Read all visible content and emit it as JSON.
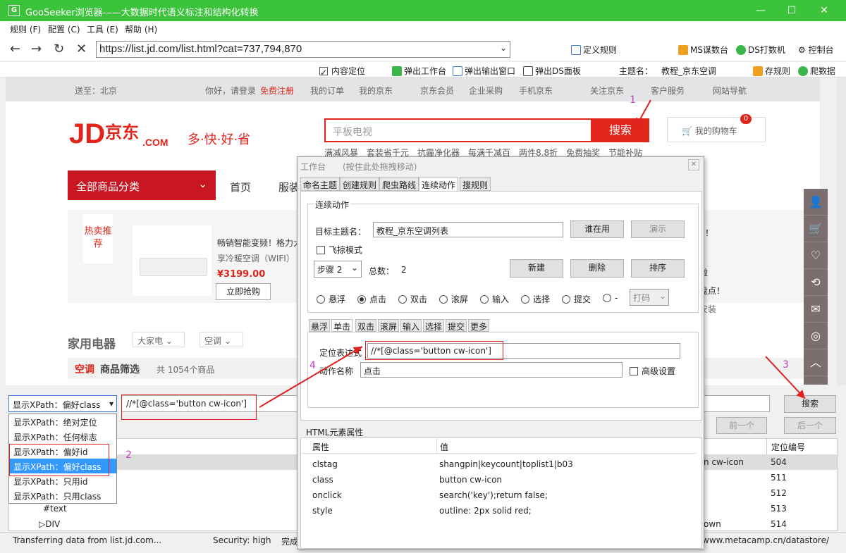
{
  "window": {
    "title": "GooSeeker浏览器——大数据时代语义标注和结构化转换",
    "logo": "G"
  },
  "menu": [
    "规则 (F)",
    "配置 (C)",
    "工具 (E)",
    "帮助 (H)"
  ],
  "nav": {
    "url": "https://list.jd.com/list.html?cat=737,794,870",
    "define_rule": "定义规则",
    "ms": "MS谋数台",
    "ds": "DS打数机",
    "console": "控制台"
  },
  "toolbar2": {
    "content_locate": "内容定位",
    "pop_workbench": "弹出工作台",
    "pop_output": "弹出输出窗口",
    "pop_ds": "弹出DS面板",
    "theme_label": "主题名：",
    "theme_value": "教程_京东空调",
    "save_rule": "存规则",
    "crawl": "爬数据"
  },
  "jd": {
    "top": {
      "ship_to": "送至：北京",
      "hello": "你好，请登录",
      "register": "免费注册",
      "orders": "我的订单",
      "myjd": "我的京东",
      "member": "京东会员",
      "enterprise": "企业采购",
      "mobile": "手机京东",
      "follow": "关注京东",
      "service": "客户服务",
      "sitenav": "网站导航"
    },
    "logo": "JD",
    "logo_cn": "京东",
    "logo_com": ".COM",
    "slogan": "多·快·好·省",
    "search_placeholder": "平板电视",
    "search_btn": "搜索",
    "cart": "我的购物车",
    "cart_count": "0",
    "hotwords": "满减风暴　套装省千元　抗霾净化器　每满千减百　两件8.8折　免费抽奖　节能补贴",
    "all_cat": "全部商品分类",
    "nav_home": "首页",
    "nav_clothes": "服装",
    "promo_tag": "热卖推荐",
    "promo_line1": "畅销智能变频！格力大",
    "promo_line2": "享冷暖空调（WIFI）",
    "price": "¥3199.00",
    "buy": "立即抢购",
    "right_text1": "到！",
    "right_text2": "啦",
    "right_text3": "盘点！",
    "right_text4": "安装",
    "cat_title": "家用电器",
    "crumb1": "大家电",
    "crumb2": "空调",
    "filter_red": "空调",
    "filter_title": "商品筛选",
    "filter_count": "共 1054个商品"
  },
  "bottom": {
    "select_value": "显示XPath：偏好class",
    "options": [
      "显示XPath：绝对定位",
      "显示XPath：任何标志",
      "显示XPath：偏好id",
      "显示XPath：偏好class",
      "显示XPath：只用id",
      "显示XPath：只用class"
    ],
    "xpath": "//*[@class='button cw-icon']",
    "search": "搜索",
    "prev": "前一个",
    "next": "后一个",
    "col_locate": "定位编号",
    "right_cell": "n cw-icon",
    "right_cell2": "own",
    "nums": [
      "504",
      "511",
      "512",
      "513",
      "514"
    ],
    "tree1": "#text",
    "tree2": "DIV"
  },
  "status": {
    "transfer": "Transferring data from list.jd.com...",
    "security": "Security: high",
    "done": "完成",
    "url": "www.metacamp.cn/datastore/"
  },
  "dialog": {
    "title": "工作台",
    "hint": "(按住此处拖拽移动)",
    "tabs": [
      "命名主题",
      "创建规则",
      "爬虫路线",
      "连续动作",
      "搜规则"
    ],
    "group": "连续动作",
    "target_label": "目标主题名：",
    "target_value": "教程_京东空调列表",
    "who_btn": "谁在用",
    "demo_btn": "演示",
    "fly": "飞掠模式",
    "step": "步骤 2",
    "total_label": "总数：",
    "total": "2",
    "new_btn": "新建",
    "del_btn": "删除",
    "sort_btn": "排序",
    "radios": [
      "悬浮",
      "点击",
      "双击",
      "滚屏",
      "输入",
      "选择",
      "提交",
      "-"
    ],
    "code": "打码",
    "subtabs": [
      "悬浮",
      "单击",
      "双击",
      "滚屏",
      "输入",
      "选择",
      "提交",
      "更多"
    ],
    "locate_label": "定位表达式",
    "locate_value": "//*[@class='button cw-icon']",
    "action_label": "动作名称",
    "action_value": "点击",
    "advanced": "高级设置",
    "attr_title": "HTML元素属性",
    "col_attr": "属性",
    "col_val": "值",
    "attrs": [
      [
        "clstag",
        "shangpin|keycount|toplist1|b03"
      ],
      [
        "class",
        "button cw-icon"
      ],
      [
        "onclick",
        "search('key');return false;"
      ],
      [
        "style",
        "outline: 2px solid red;"
      ]
    ]
  },
  "annotations": [
    "1",
    "2",
    "3",
    "4"
  ],
  "colors": {
    "title_green": "#3bc43b",
    "jd_red": "#e1251b",
    "anno": "#c040c0"
  }
}
